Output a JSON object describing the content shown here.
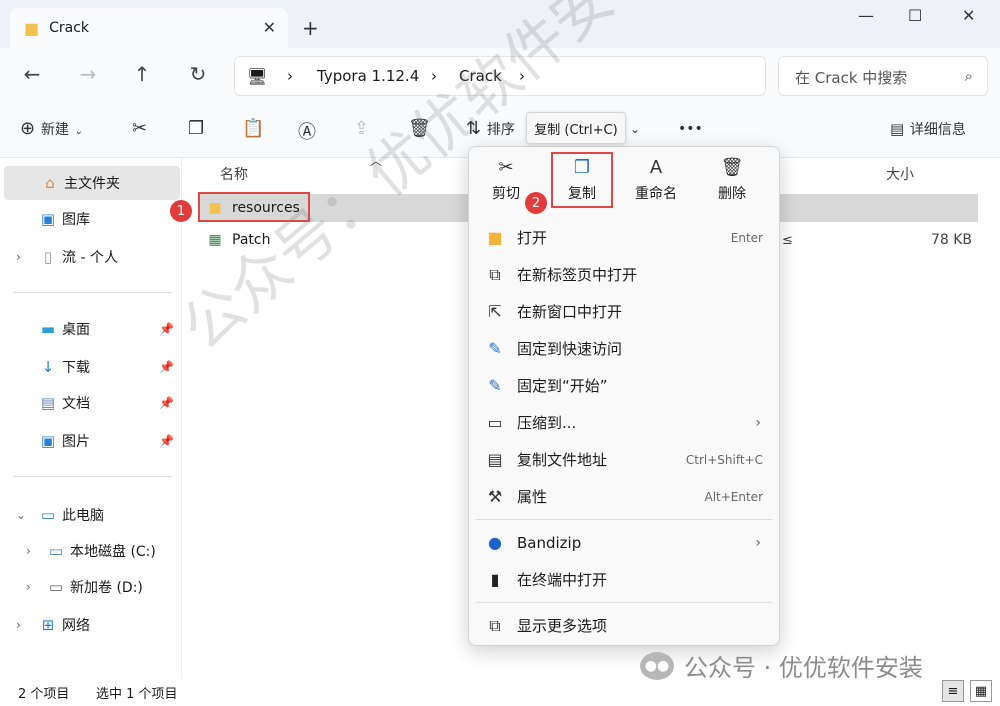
{
  "window": {
    "tab_title": "Crack",
    "tab_close": "✕",
    "new_tab": "+",
    "minimize": "—",
    "maximize": "☐",
    "close": "✕"
  },
  "nav": {
    "back": "←",
    "forward": "→",
    "up": "↑",
    "refresh": "↻",
    "pc_icon": "🖥",
    "sep": "›",
    "breadcrumb": [
      "Typora 1.12.4",
      "Crack"
    ],
    "search_placeholder": "在 Crack 中搜索",
    "search_icon": "⌕"
  },
  "toolbar": {
    "new_label": "新建",
    "sort_label": "排序",
    "more": "•••",
    "details_label": "详细信息",
    "tooltip": "复制 (Ctrl+C)"
  },
  "sidebar": {
    "home": "主文件夹",
    "gallery": "图库",
    "personal": "流 - 个人",
    "desktop": "桌面",
    "downloads": "下载",
    "documents": "文档",
    "pictures": "图片",
    "this_pc": "此电脑",
    "drive_c": "本地磁盘 (C:)",
    "drive_d": "新加卷 (D:)",
    "network": "网络"
  },
  "content": {
    "col_name": "名称",
    "col_size": "大小",
    "files": [
      {
        "name": "resources",
        "size": ""
      },
      {
        "name": "Patch",
        "size": "78 KB"
      }
    ],
    "partial_type": "≤"
  },
  "badges": {
    "one": "1",
    "two": "2"
  },
  "context_menu": {
    "quick": [
      {
        "label": "剪切",
        "icon": "✂"
      },
      {
        "label": "复制",
        "icon": "❐"
      },
      {
        "label": "重命名",
        "icon": "A"
      },
      {
        "label": "删除",
        "icon": "🗑"
      }
    ],
    "items": [
      {
        "label": "打开",
        "key": "Enter"
      },
      {
        "label": "在新标签页中打开",
        "key": ""
      },
      {
        "label": "在新窗口中打开",
        "key": ""
      },
      {
        "label": "固定到快速访问",
        "key": ""
      },
      {
        "label": "固定到“开始”",
        "key": ""
      },
      {
        "label": "压缩到...",
        "key": ""
      },
      {
        "label": "复制文件地址",
        "key": "Ctrl+Shift+C"
      },
      {
        "label": "属性",
        "key": "Alt+Enter"
      },
      {
        "label": "Bandizip",
        "key": ""
      },
      {
        "label": "在终端中打开",
        "key": ""
      },
      {
        "label": "显示更多选项",
        "key": ""
      }
    ],
    "arrow": "›"
  },
  "status": {
    "count": "2 个项目",
    "selected": "选中 1 个项目"
  },
  "watermark": "公众号：优优软件安装",
  "brand": "公众号 · 优优软件安装"
}
